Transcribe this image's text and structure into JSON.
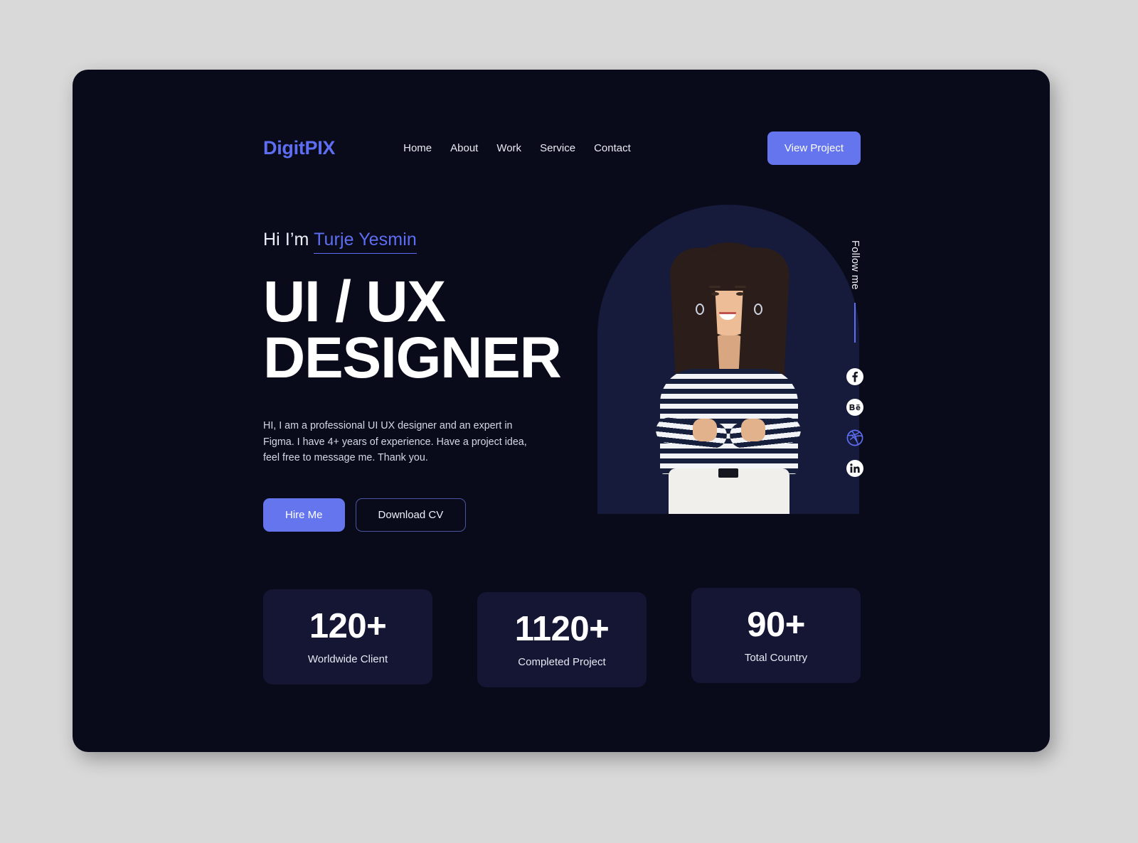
{
  "theme": {
    "page_background": "#d9d9d9",
    "card_background": "#0a0b1a",
    "accent": "#6475ee",
    "accent_text": "#5d6ef2",
    "arch_background": "#161a3b",
    "stat_card_background": "#141634",
    "text_primary": "#ffffff",
    "text_muted": "#d4d7e6"
  },
  "header": {
    "brand": "DigitPIX",
    "nav": [
      {
        "label": "Home"
      },
      {
        "label": "About"
      },
      {
        "label": "Work"
      },
      {
        "label": "Service"
      },
      {
        "label": "Contact"
      }
    ],
    "cta_label": "View Project"
  },
  "hero": {
    "greeting_prefix": "Hi I’m ",
    "name": "Turje Yesmin",
    "headline_line_1": "UI / UX",
    "headline_line_2": "DESIGNER",
    "bio": "HI, I am a professional UI UX designer and an expert in Figma. I have 4+ years of experience. Have a project idea, feel free to message me. Thank you.",
    "primary_button": "Hire Me",
    "secondary_button": "Download CV"
  },
  "follow": {
    "label": "Follow me",
    "socials": [
      {
        "name": "facebook-icon",
        "title": "Facebook"
      },
      {
        "name": "behance-icon",
        "title": "Behance"
      },
      {
        "name": "dribbble-icon",
        "title": "Dribbble"
      },
      {
        "name": "linkedin-icon",
        "title": "LinkedIn"
      }
    ]
  },
  "stats": [
    {
      "value": "120+",
      "label": "Worldwide Client"
    },
    {
      "value": "1120+",
      "label": "Completed Project"
    },
    {
      "value": "90+",
      "label": "Total Country"
    }
  ]
}
